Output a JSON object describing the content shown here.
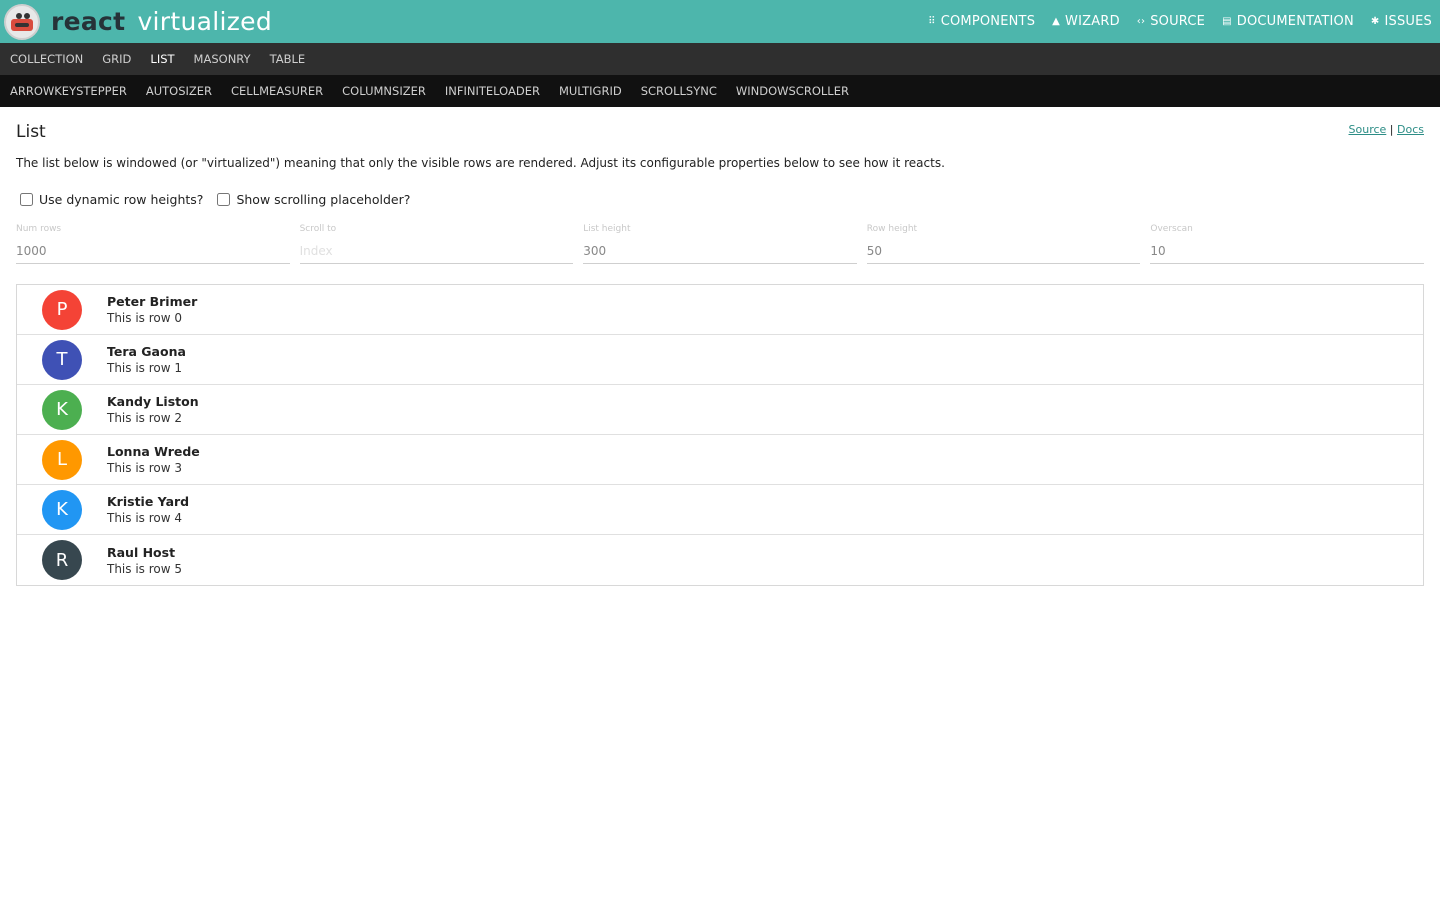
{
  "header": {
    "brand_primary": "react",
    "brand_secondary": "virtualized",
    "nav": [
      {
        "label": "COMPONENTS",
        "icon": "grid-icon"
      },
      {
        "label": "WIZARD",
        "icon": "wand-icon"
      },
      {
        "label": "SOURCE",
        "icon": "code-icon"
      },
      {
        "label": "DOCUMENTATION",
        "icon": "book-icon"
      },
      {
        "label": "ISSUES",
        "icon": "bug-icon"
      }
    ]
  },
  "nav_components": [
    "COLLECTION",
    "GRID",
    "LIST",
    "MASONRY",
    "TABLE"
  ],
  "nav_components_active": "LIST",
  "nav_hocs": [
    "ARROWKEYSTEPPER",
    "AUTOSIZER",
    "CELLMEASURER",
    "COLUMNSIZER",
    "INFINITELOADER",
    "MULTIGRID",
    "SCROLLSYNC",
    "WINDOWSCROLLER"
  ],
  "page": {
    "title": "List",
    "source_link": "Source",
    "separator": "|",
    "docs_link": "Docs",
    "description": "The list below is windowed (or \"virtualized\") meaning that only the visible rows are rendered. Adjust its configurable properties below to see how it reacts."
  },
  "options": {
    "dynamic_heights_label": "Use dynamic row heights?",
    "placeholder_label": "Show scrolling placeholder?"
  },
  "fields": [
    {
      "label": "Num rows",
      "value": "1000",
      "placeholder": ""
    },
    {
      "label": "Scroll to",
      "value": "",
      "placeholder": "Index"
    },
    {
      "label": "List height",
      "value": "300",
      "placeholder": ""
    },
    {
      "label": "Row height",
      "value": "50",
      "placeholder": ""
    },
    {
      "label": "Overscan",
      "value": "10",
      "placeholder": ""
    }
  ],
  "rows": [
    {
      "letter": "P",
      "name": "Peter Brimer",
      "text": "This is row 0",
      "color": "#f44336"
    },
    {
      "letter": "T",
      "name": "Tera Gaona",
      "text": "This is row 1",
      "color": "#3f51b5"
    },
    {
      "letter": "K",
      "name": "Kandy Liston",
      "text": "This is row 2",
      "color": "#4caf50"
    },
    {
      "letter": "L",
      "name": "Lonna Wrede",
      "text": "This is row 3",
      "color": "#ff9800"
    },
    {
      "letter": "K",
      "name": "Kristie Yard",
      "text": "This is row 4",
      "color": "#2196f3"
    },
    {
      "letter": "R",
      "name": "Raul Host",
      "text": "This is row 5",
      "color": "#37474f"
    }
  ]
}
